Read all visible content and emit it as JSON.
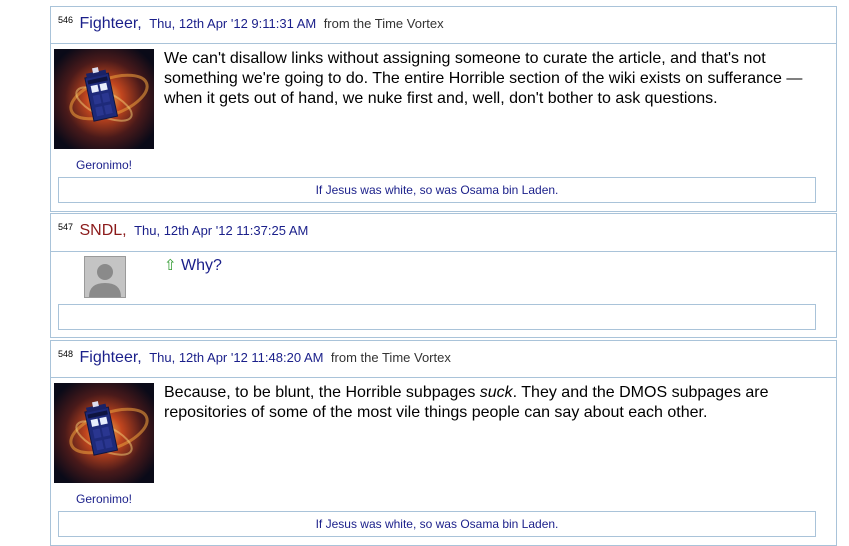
{
  "posts": [
    {
      "number": "546",
      "author": "Fighteer",
      "timestamp": "Thu, 12th Apr '12 9:11:31 AM",
      "origin": "from the Time Vortex",
      "avatar_caption": "Geronimo!",
      "body": "We can't disallow links without assigning someone to curate the article, and that's not something we're going to do. The entire Horrible section of the wiki exists on sufferance — when it gets out of hand, we nuke first and, well, don't bother to ask questions.",
      "signature": "If Jesus was white, so was Osama bin Laden."
    },
    {
      "number": "547",
      "author": "SNDL",
      "timestamp": "Thu, 12th Apr '12 11:37:25 AM",
      "body_link": "Why?",
      "signature": ""
    },
    {
      "number": "548",
      "author": "Fighteer",
      "timestamp": "Thu, 12th Apr '12 11:48:20 AM",
      "origin": "from the Time Vortex",
      "avatar_caption": "Geronimo!",
      "body_before": "Because, to be blunt, the Horrible subpages ",
      "body_em": "suck",
      "body_after": ". They and the DMOS subpages are repositories of some of the most vile things people can say about each other.",
      "signature": "If Jesus was white, so was Osama bin Laden."
    }
  ],
  "colors": {
    "border": "#a9c3d9",
    "link_blue": "#1a1f8a",
    "author_red": "#8b1a1a",
    "arrow_green": "#2f9a2f"
  }
}
